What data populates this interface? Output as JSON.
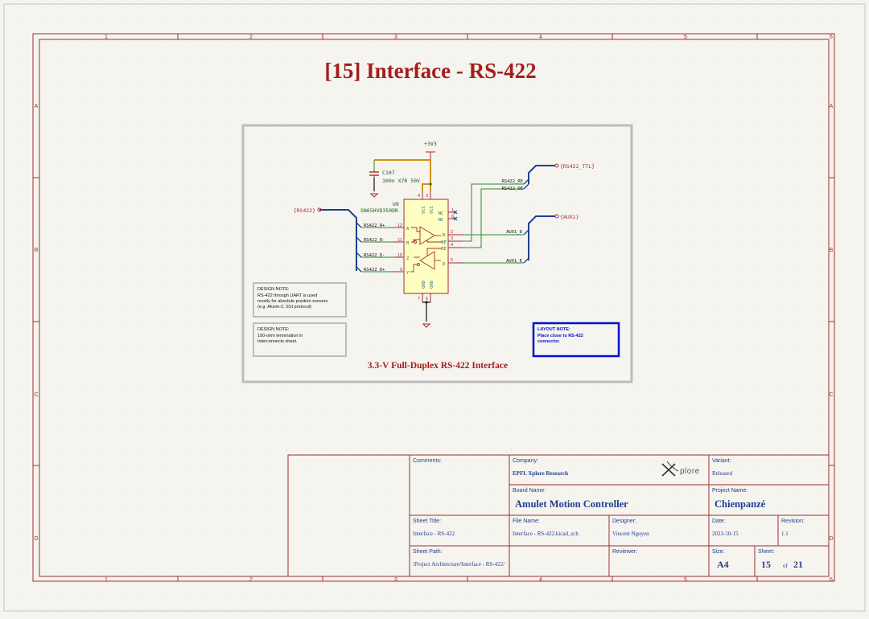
{
  "page_title": "[15] Interface - RS-422",
  "border": {
    "col_labels": [
      "1",
      "2",
      "3",
      "4",
      "5",
      "6"
    ],
    "row_labels": [
      "A",
      "B",
      "C",
      "D"
    ]
  },
  "group_box": {
    "title": "3.3-V Full-Duplex RS-422 Interface"
  },
  "power": {
    "supply": "+3V3"
  },
  "capacitor": {
    "ref": "C107",
    "value": "100n X7R 50V"
  },
  "ic": {
    "ref": "U9",
    "part": "SN65HVD350DR",
    "vcc1": "VCC",
    "vcc2": "VCC",
    "gnd1": "GND",
    "gnd2": "GND",
    "nc1": "NC",
    "nc2": "NC",
    "pin_a": "A",
    "pin_b": "B",
    "pin_z": "Z",
    "pin_y": "Y",
    "pin_r": "R",
    "pin_re": "RE",
    "pin_de": "DE",
    "pin_d": "D",
    "num_vcc1": "4",
    "num_vcc2": "3",
    "num_gnd1": "7",
    "num_gnd2": "6",
    "num_nc1": "1",
    "num_nc2": "8",
    "num_a": "12",
    "num_b": "11",
    "num_z": "10",
    "num_y": "9",
    "num_r": "2",
    "num_re": "3",
    "num_de": "4",
    "num_d": "5"
  },
  "buses": {
    "left": "{RS422}",
    "top": "{RS422_TTL}",
    "aux": "{AUX1}"
  },
  "nets": {
    "rs422_rp": "RS422_R+",
    "rs422_rm": "RS422_R-",
    "rs422_dm": "RS422_D-",
    "rs422_dp": "RS422_D+",
    "rs422_re": "RS422_RE",
    "rs422_de": "RS422_DE",
    "aux1_d": "AUX1_D",
    "aux1_e": "AUX1_E"
  },
  "notes": {
    "design_note_1": {
      "title": "DESIGN NOTE:",
      "lines": [
        "RS-422 through UART is used",
        "mostly for absolute position sensors",
        "(e.g. Aksim-2, SSI protocol)"
      ]
    },
    "design_note_2": {
      "title": "DESIGN NOTE:",
      "lines": [
        "100-ohm termination in",
        "Interconnects sheet."
      ]
    },
    "layout_note": {
      "title": "LAYOUT NOTE:",
      "lines": [
        "Place close to RS-422",
        "connector."
      ]
    }
  },
  "title_block": {
    "comments_label": "Comments:",
    "company_label": "Company:",
    "company": "EPFL Xplore Research",
    "logo_text": "plore",
    "variant_label": "Variant:",
    "variant": "Released",
    "board_name_label": "Board Name:",
    "board_name": "Amulet Motion Controller",
    "project_name_label": "Project Name:",
    "project_name": "Chienpanzé",
    "sheet_title_label": "Sheet Title:",
    "sheet_title": "Interface - RS-422",
    "file_name_label": "File Name:",
    "file_name": "Interface - RS-422.kicad_sch",
    "designer_label": "Designer:",
    "designer": "Vincent Nguyen",
    "date_label": "Date:",
    "date": "2023-10-15",
    "revision_label": "Revision:",
    "revision": "1.1",
    "sheet_path_label": "Sheet Path:",
    "sheet_path": "/Project Architecture/Interface - RS-422/",
    "reviewer_label": "Reviewer:",
    "reviewer": "",
    "size_label": "Size:",
    "size": "A4",
    "sheet_label": "Sheet:",
    "sheet_num": "15",
    "sheet_of": "of",
    "sheet_total": "21"
  },
  "colors": {
    "frame": "#a42c2c",
    "wire": "#2b8a2b",
    "bus": "#1f3f8f",
    "power": "#d4900c",
    "ic_fill": "#ffffc2",
    "title": "#a31d1d",
    "layout_note": "#0011cc"
  }
}
